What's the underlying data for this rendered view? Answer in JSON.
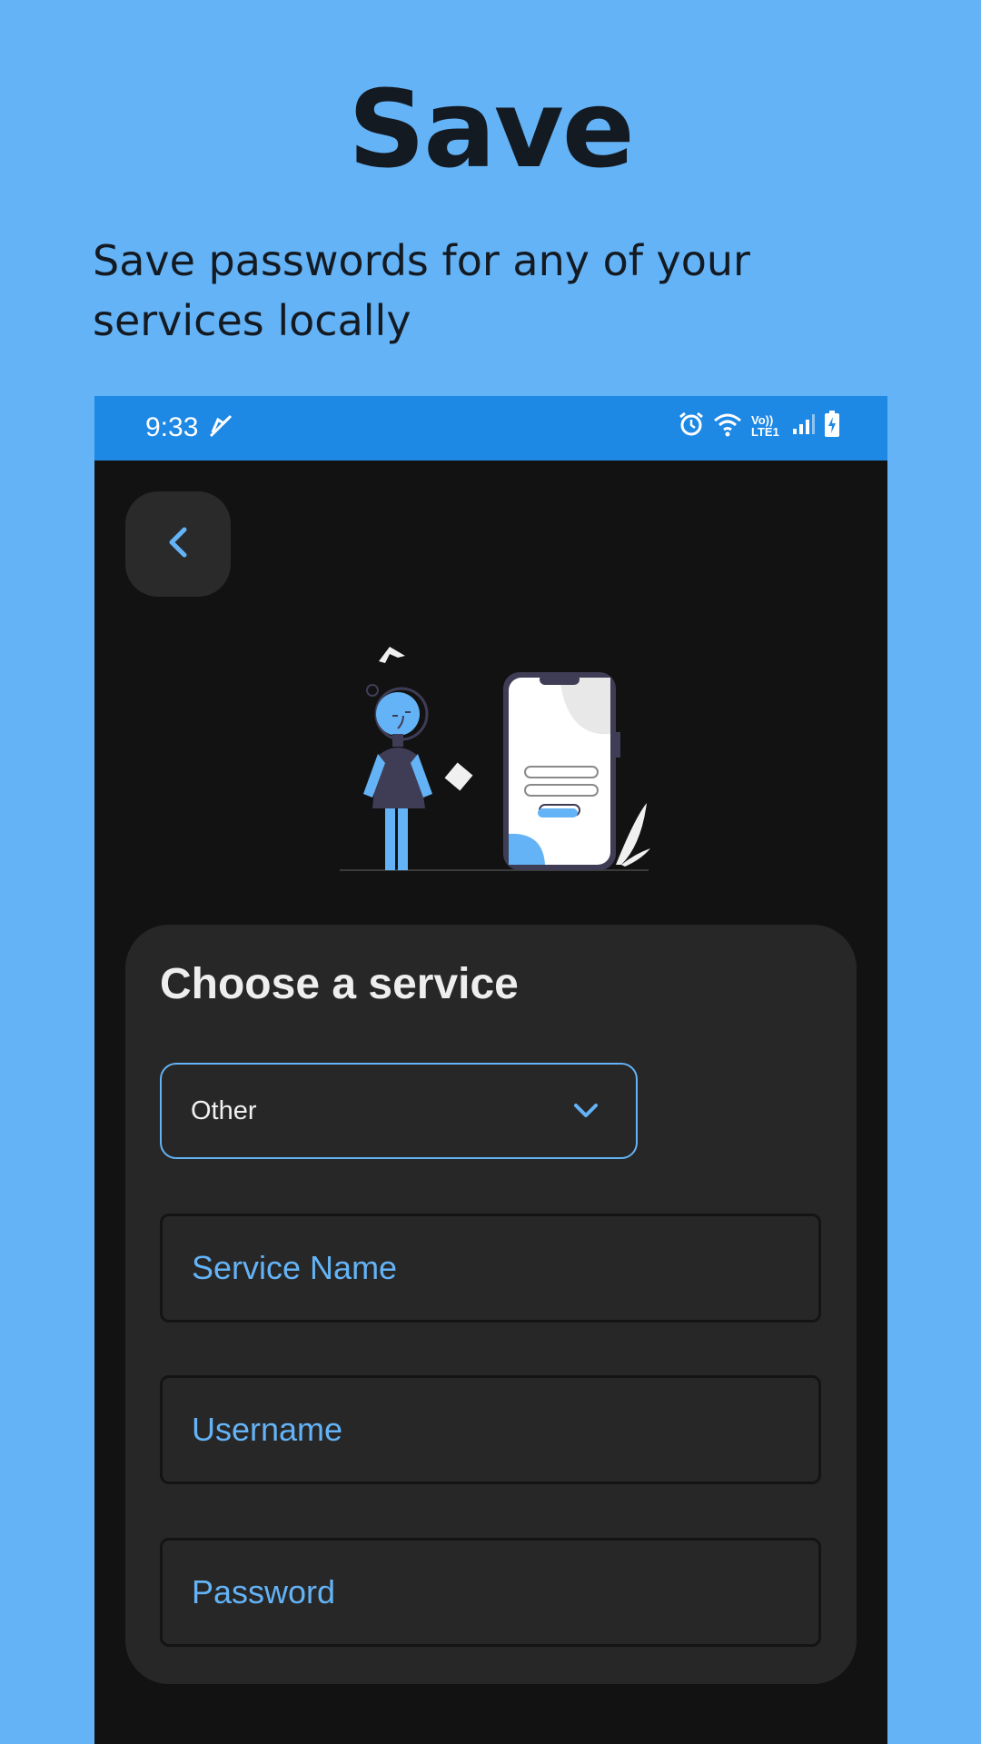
{
  "promo": {
    "title": "Save",
    "subtitle": "Save passwords for any of your services locally"
  },
  "status_bar": {
    "time": "9:33",
    "network_label": "Vo)) LTE1"
  },
  "icons": {
    "back": "chevron-left-icon",
    "dropdown": "chevron-down-icon"
  },
  "form": {
    "title": "Choose a service",
    "service_select": {
      "selected": "Other"
    },
    "service_name": {
      "placeholder": "Service Name"
    },
    "username": {
      "placeholder": "Username"
    },
    "password": {
      "placeholder": "Password"
    }
  },
  "colors": {
    "page_background": "#64b3f6",
    "status_bar": "#1e88e5",
    "app_background": "#121212",
    "card_background": "#272727",
    "accent": "#64b3f6"
  }
}
